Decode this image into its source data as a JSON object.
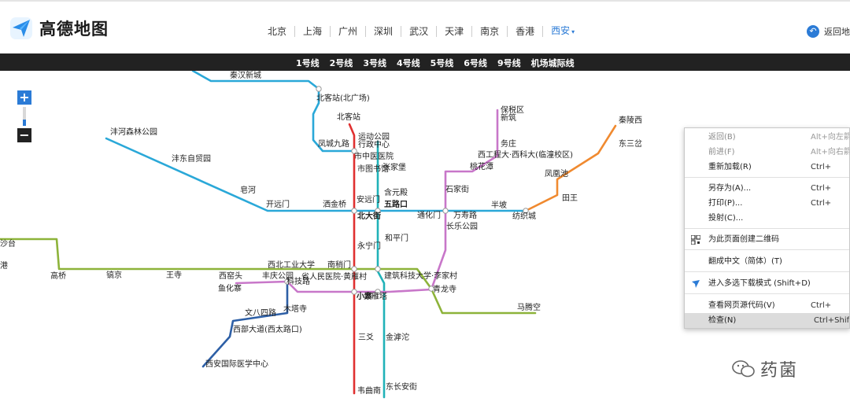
{
  "header": {
    "logo_text": "高德地图",
    "cities": [
      "北京",
      "上海",
      "广州",
      "深圳",
      "武汉",
      "天津",
      "南京",
      "香港"
    ],
    "active_city": "西安",
    "back_label": "返回地"
  },
  "linebar": [
    "1号线",
    "2号线",
    "3号线",
    "4号线",
    "5号线",
    "6号线",
    "9号线",
    "机场城际线"
  ],
  "colors": {
    "line1": "#8db33a",
    "line2": "#e03030",
    "line3": "#c877c9",
    "line4": "#20b2b8",
    "line5": "#a8cc5a",
    "line6": "#2d5fa6",
    "line9": "#f08a30",
    "airport": "#2aa8d8"
  },
  "stations": [
    {
      "id": "s1",
      "name": "秦汉新城"
    },
    {
      "id": "s2",
      "name": "北客站(北广场)"
    },
    {
      "id": "s3",
      "name": "北客站"
    },
    {
      "id": "s4",
      "name": "沣河森林公园"
    },
    {
      "id": "s5",
      "name": "运动公园"
    },
    {
      "id": "s6",
      "name": "行政中心"
    },
    {
      "id": "s7",
      "name": "凤城九路"
    },
    {
      "id": "s8",
      "name": "市中医医院"
    },
    {
      "id": "s9",
      "name": "沣东自贸园"
    },
    {
      "id": "s10",
      "name": "市图书馆"
    },
    {
      "id": "s11",
      "name": "张家堡"
    },
    {
      "id": "s12",
      "name": "皂河"
    },
    {
      "id": "s13",
      "name": "开远门"
    },
    {
      "id": "s14",
      "name": "西安站"
    },
    {
      "id": "s15",
      "name": "安远门"
    },
    {
      "id": "s16",
      "name": "含元殿"
    },
    {
      "id": "s17",
      "name": "五路口"
    },
    {
      "id": "s18",
      "name": "北大街"
    },
    {
      "id": "s19",
      "name": "洒金桥"
    },
    {
      "id": "s20",
      "name": "石家街"
    },
    {
      "id": "s21",
      "name": "通化门"
    },
    {
      "id": "s22",
      "name": "万寿路"
    },
    {
      "id": "s23",
      "name": "长乐公园"
    },
    {
      "id": "s24",
      "name": "半坡"
    },
    {
      "id": "s25",
      "name": "纺织城"
    },
    {
      "id": "s26",
      "name": "保税区"
    },
    {
      "id": "s27",
      "name": "新筑"
    },
    {
      "id": "s28",
      "name": "务庄"
    },
    {
      "id": "s29",
      "name": "西工程大·西科大(临潼校区)"
    },
    {
      "id": "s30",
      "name": "秦陵西"
    },
    {
      "id": "s31",
      "name": "东三岔"
    },
    {
      "id": "s32",
      "name": "凤凰池"
    },
    {
      "id": "s33",
      "name": "田王"
    },
    {
      "id": "s34",
      "name": "桃花潭"
    },
    {
      "id": "s35",
      "name": "和平门"
    },
    {
      "id": "s36",
      "name": "永宁门"
    },
    {
      "id": "s37",
      "name": "西北工业大学"
    },
    {
      "id": "s38",
      "name": "南稍门"
    },
    {
      "id": "s39",
      "name": "高桥"
    },
    {
      "id": "s40",
      "name": "镐京"
    },
    {
      "id": "s41",
      "name": "王寺"
    },
    {
      "id": "s42",
      "name": "西窑头"
    },
    {
      "id": "s43",
      "name": "丰庆公园"
    },
    {
      "id": "s44",
      "name": "省人民医院·黄雁村"
    },
    {
      "id": "s45",
      "name": "建筑科技大学·李家村"
    },
    {
      "id": "s46",
      "name": "鱼化寨"
    },
    {
      "id": "s47",
      "name": "科技路"
    },
    {
      "id": "s48",
      "name": "木塔寺"
    },
    {
      "id": "s49",
      "name": "小寨"
    },
    {
      "id": "s50",
      "name": "大雁塔"
    },
    {
      "id": "s51",
      "name": "青龙寺"
    },
    {
      "id": "s52",
      "name": "马腾空"
    },
    {
      "id": "s53",
      "name": "文八四路"
    },
    {
      "id": "s54",
      "name": "西部大道(西太路口)"
    },
    {
      "id": "s55",
      "name": "三爻"
    },
    {
      "id": "s56",
      "name": "金滹沱"
    },
    {
      "id": "s57",
      "name": "西安国际医学中心"
    },
    {
      "id": "s58",
      "name": "韦曲南"
    },
    {
      "id": "s59",
      "name": "东长安街"
    },
    {
      "id": "s60",
      "name": "沙台"
    },
    {
      "id": "s61",
      "name": "港"
    }
  ],
  "zoom": {
    "in_label": "+",
    "out_label": "−",
    "level": 0.35
  },
  "context_menu": [
    {
      "label": "返回(B)",
      "shortcut": "Alt+向左箭",
      "disabled": true
    },
    {
      "label": "前进(F)",
      "shortcut": "Alt+向右箭",
      "disabled": true
    },
    {
      "label": "重新加载(R)",
      "shortcut": "Ctrl+",
      "disabled": false
    },
    {
      "label": "另存为(A)...",
      "shortcut": "Ctrl+",
      "disabled": false
    },
    {
      "label": "打印(P)...",
      "shortcut": "Ctrl+",
      "disabled": false
    },
    {
      "label": "投射(C)...",
      "shortcut": "",
      "disabled": false
    },
    {
      "label": "为此页面创建二维码",
      "shortcut": "",
      "disabled": false,
      "icon": "qr-code-icon"
    },
    {
      "label": "翻成中文（简体）(T)",
      "shortcut": "",
      "disabled": false
    },
    {
      "label": "进入多选下载模式 (Shift+D)",
      "shortcut": "",
      "disabled": false,
      "icon": "download-bird-icon"
    },
    {
      "label": "查看网页源代码(V)",
      "shortcut": "Ctrl+",
      "disabled": false
    },
    {
      "label": "检查(N)",
      "shortcut": "Ctrl+Shift",
      "disabled": false,
      "highlighted": true
    }
  ],
  "watermark": {
    "text": "药菌",
    "icon": "wechat-icon"
  }
}
